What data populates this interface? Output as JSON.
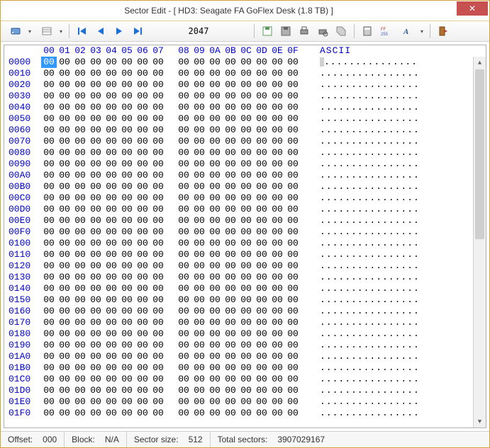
{
  "window": {
    "title": "Sector Edit - [ HD3: Seagate FA GoFlex Desk (1.8 TB) ]"
  },
  "toolbar": {
    "sector_value": "2047"
  },
  "hex": {
    "col_headers": [
      "00",
      "01",
      "02",
      "03",
      "04",
      "05",
      "06",
      "07",
      "08",
      "09",
      "0A",
      "0B",
      "0C",
      "0D",
      "0E",
      "0F"
    ],
    "ascii_header": "ASCII",
    "row_offsets": [
      "0000",
      "0010",
      "0020",
      "0030",
      "0040",
      "0050",
      "0060",
      "0070",
      "0080",
      "0090",
      "00A0",
      "00B0",
      "00C0",
      "00D0",
      "00E0",
      "00F0",
      "0100",
      "0110",
      "0120",
      "0130",
      "0140",
      "0150",
      "0160",
      "0170",
      "0180",
      "0190",
      "01A0",
      "01B0",
      "01C0",
      "01D0",
      "01E0",
      "01F0"
    ],
    "byte_value": "00",
    "ascii_value": "................",
    "selected": {
      "row": 0,
      "col": 0
    }
  },
  "status": {
    "offset_label": "Offset:",
    "offset_value": "000",
    "block_label": "Block:",
    "block_value": "N/A",
    "sector_size_label": "Sector size:",
    "sector_size_value": "512",
    "total_sectors_label": "Total sectors:",
    "total_sectors_value": "3907029167"
  }
}
